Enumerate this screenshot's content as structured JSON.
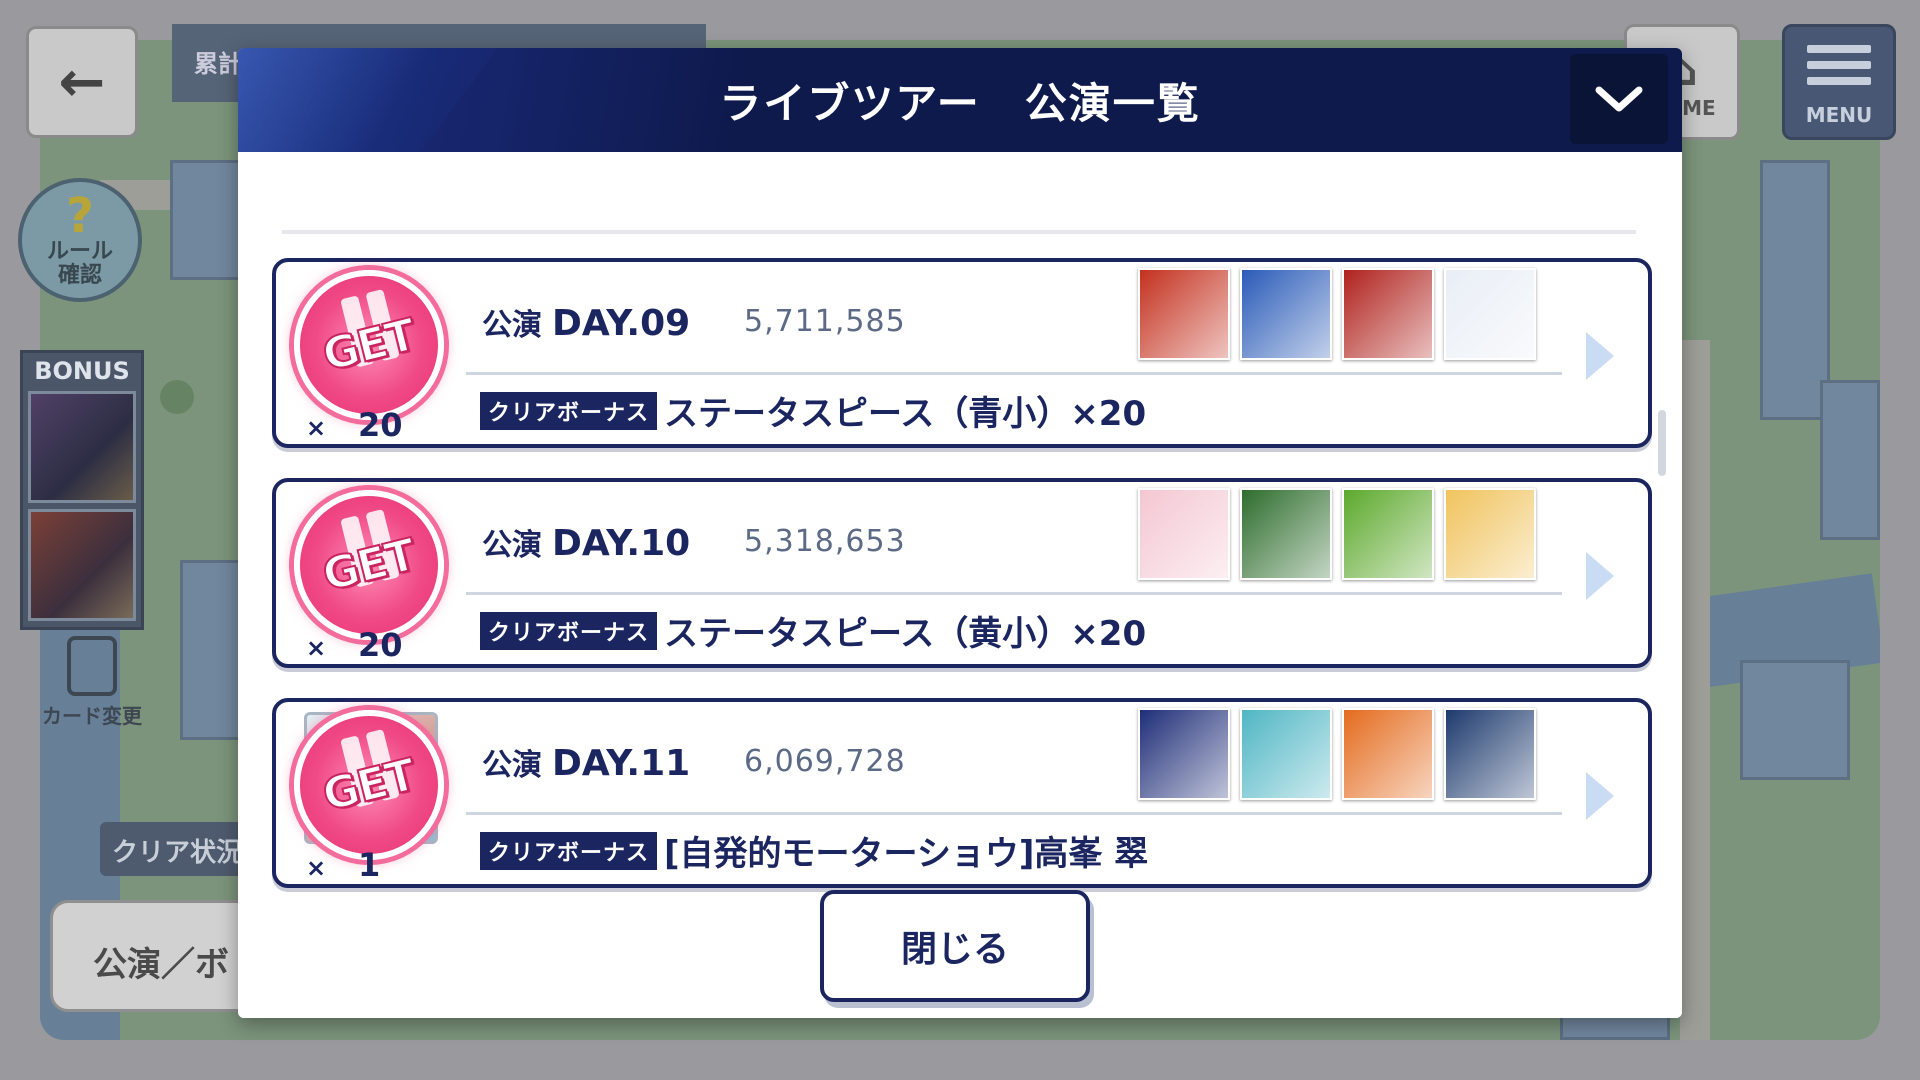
{
  "background": {
    "back_label": "←",
    "total_label": "累計",
    "home_label": "HOME",
    "menu_label": "MENU",
    "rule_label_1": "ルール",
    "rule_label_2": "確認",
    "bonus_title": "BONUS",
    "card_change_label": "カード変更",
    "clear_status_label": "クリア状況",
    "perf_button_label": "公演／ボ"
  },
  "modal": {
    "title": "ライブツアー　公演一覧",
    "close_label": "閉じる"
  },
  "rows": [
    {
      "stage_prefix": "公演",
      "day": "DAY.09",
      "score": "5,711,585",
      "bonus_tag": "クリアボーナス",
      "bonus_text": "ステータスピース（青小）×20",
      "qty_x": "×",
      "qty": "20",
      "get": "GET",
      "thumb_colors": [
        "#c4311f",
        "#2a5bb8",
        "#b0221d",
        "#e9eef6"
      ]
    },
    {
      "stage_prefix": "公演",
      "day": "DAY.10",
      "score": "5,318,653",
      "bonus_tag": "クリアボーナス",
      "bonus_text": "ステータスピース（黄小）×20",
      "qty_x": "×",
      "qty": "20",
      "get": "GET",
      "thumb_colors": [
        "#f4c7d2",
        "#2e6d2d",
        "#5ca92c",
        "#f0c35d"
      ]
    },
    {
      "stage_prefix": "公演",
      "day": "DAY.11",
      "score": "6,069,728",
      "bonus_tag": "クリアボーナス",
      "bonus_text": "[自発的モーターショウ]高峯 翠",
      "qty_x": "×",
      "qty": "1",
      "get": "GET",
      "thumb_colors": [
        "#1f2e78",
        "#4fb6c4",
        "#e46b1e",
        "#1d3a6e"
      ]
    }
  ],
  "colors": {
    "navy": "#1b2560",
    "header": "#0e1a4c",
    "get_pink": "#f04a86",
    "arrow": "#c9dcf4"
  }
}
